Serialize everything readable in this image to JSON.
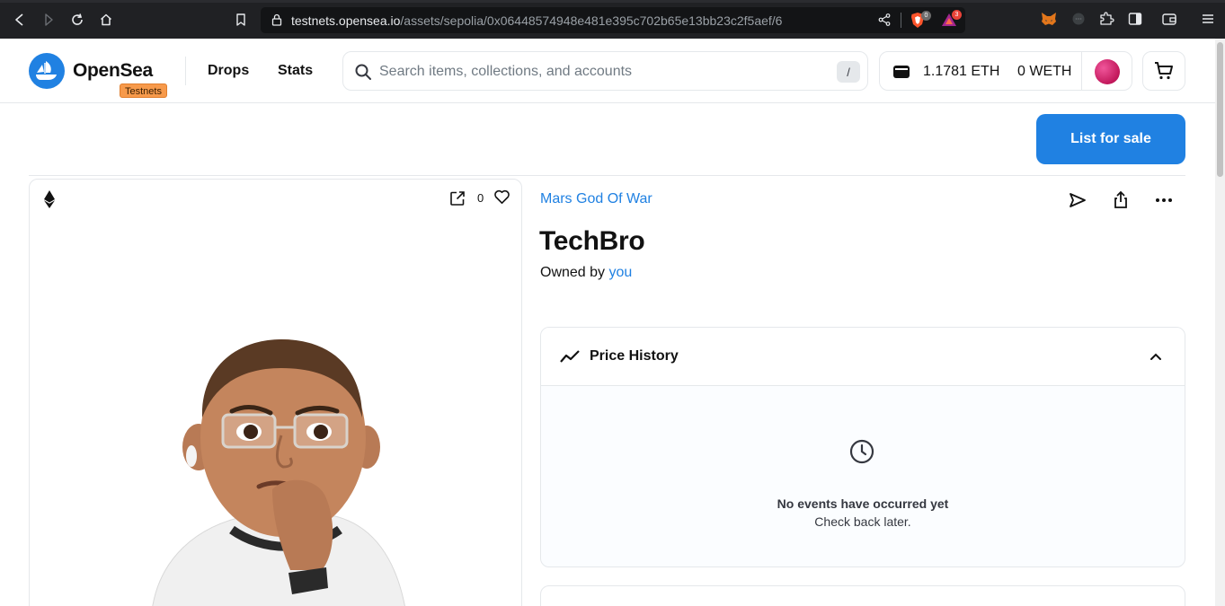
{
  "browser": {
    "url_host": "testnets.opensea.io",
    "url_path": "/assets/sepolia/0x06448574948e481e395c702b65e13bb23c2f5aef/6",
    "shield_count": "0",
    "rewards_count": "3"
  },
  "header": {
    "brand": "OpenSea",
    "badge": "Testnets",
    "nav": [
      "Drops",
      "Stats"
    ],
    "search_placeholder": "Search items, collections, and accounts",
    "search_shortcut": "/",
    "eth_balance": "1.1781 ETH",
    "weth_balance": "0 WETH"
  },
  "actions": {
    "list_for_sale": "List for sale"
  },
  "asset": {
    "favorite_count": "0",
    "collection": "Mars God Of War",
    "title": "TechBro",
    "owned_by_label": "Owned by",
    "owner": "you"
  },
  "price_history": {
    "title": "Price History",
    "empty_title": "No events have occurred yet",
    "empty_sub": "Check back later."
  },
  "colors": {
    "accent": "#2081e2",
    "badge": "#f79a4b"
  }
}
